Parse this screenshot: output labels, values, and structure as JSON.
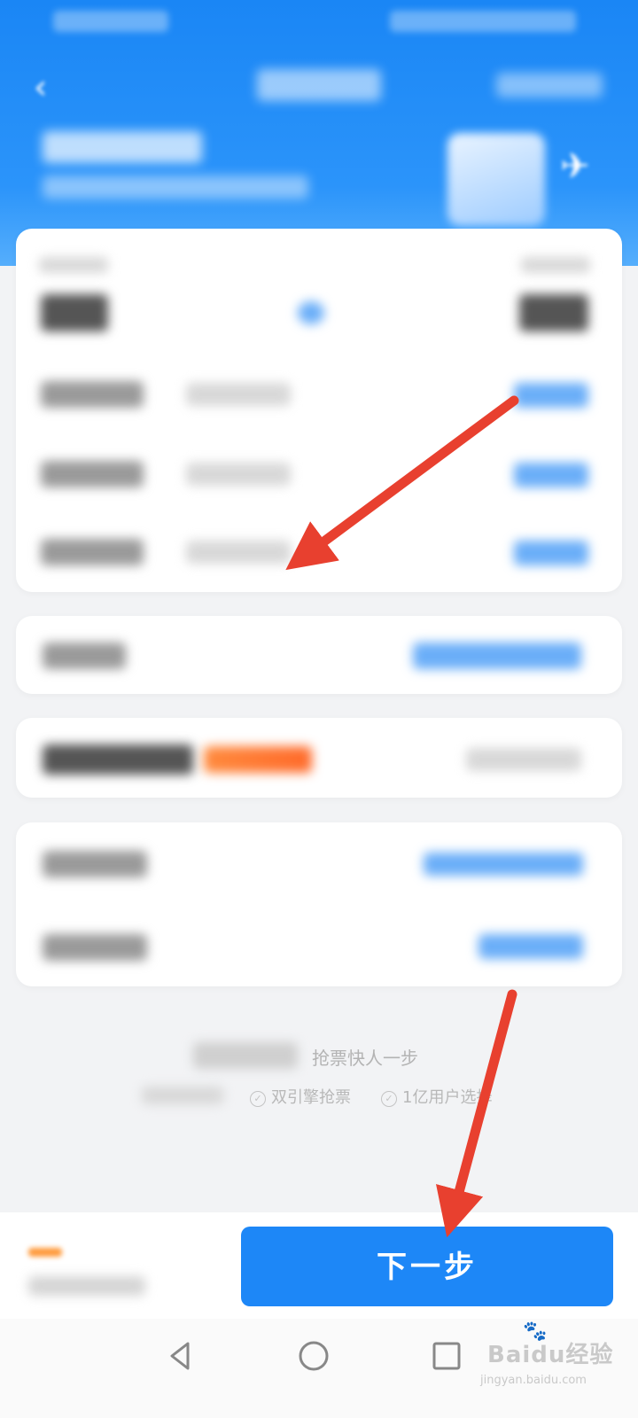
{
  "header": {
    "back_icon": "chevron-left-icon",
    "banner_icon": "plane-icon",
    "accent_color": "#1a86f5"
  },
  "promo": {
    "tagline": "抢票快人一步",
    "features": [
      "双引擎抢票",
      "1亿用户选择"
    ]
  },
  "bottom_bar": {
    "next_label": "下一步",
    "button_color": "#1d87f7"
  },
  "system_nav": {
    "back": "triangle-back-icon",
    "home": "circle-home-icon",
    "recents": "square-recents-icon"
  },
  "watermark": {
    "main": "Baidu经验",
    "sub": "jingyan.baidu.com"
  },
  "annotations": {
    "arrow_color": "#e8402f"
  }
}
